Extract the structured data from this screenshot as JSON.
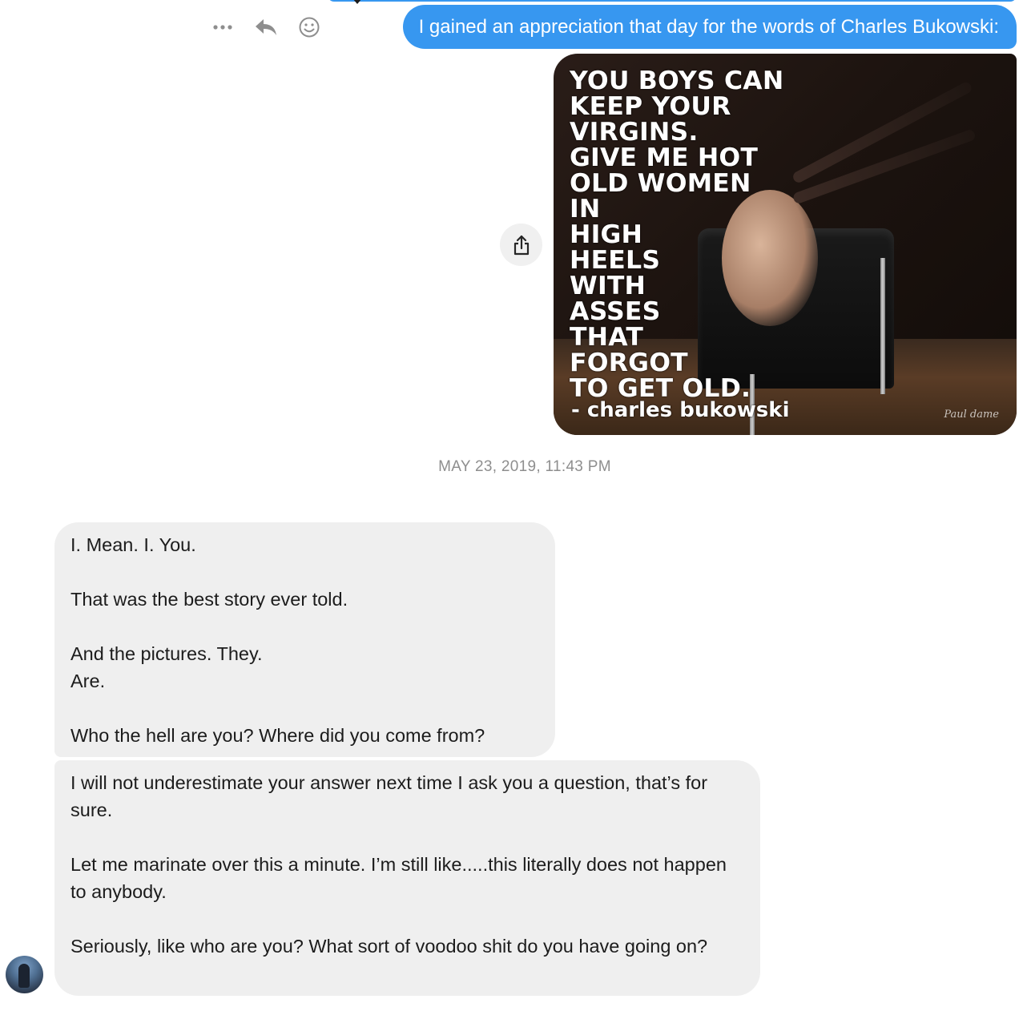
{
  "conversation": {
    "outgoing_text": "I gained an appreciation that day for the words of Charles Bukowski:",
    "image_message": {
      "quote_lines": "YOU BOYS CAN\nKEEP YOUR\nVIRGINS.\nGIVE ME HOT\nOLD WOMEN\nIN\nHIGH\nHEELS\nWITH\nASSES\nTHAT\nFORGOT\nTO GET OLD.",
      "author": "- charles bukowski",
      "signature": "Paul dame"
    },
    "timestamp": "MAY 23, 2019, 11:43 PM",
    "incoming_1": {
      "paragraph_1": "I. Mean. I. You.",
      "paragraph_2": "That was the best story ever told.",
      "paragraph_3_line_1": "And the pictures. They.",
      "paragraph_3_line_2": "Are.",
      "paragraph_4": "Who the hell are you? Where did you come from?"
    },
    "incoming_2": {
      "paragraph_1": "I will not underestimate your answer next time I ask you a question, that’s for sure.",
      "paragraph_2": "Let me marinate over this a minute. I’m still like.....this literally does not happen to anybody.",
      "paragraph_3": "Seriously, like who are you? What sort of voodoo shit do you have going on?"
    }
  },
  "icons": {
    "more": "more-options-icon",
    "reply": "reply-icon",
    "react": "emoji-react-icon",
    "share": "share-icon",
    "avatar": "avatar"
  },
  "colors": {
    "outgoing_bubble": "#3797f0",
    "incoming_bubble": "#efefef",
    "timestamp": "#8e8e8e"
  }
}
